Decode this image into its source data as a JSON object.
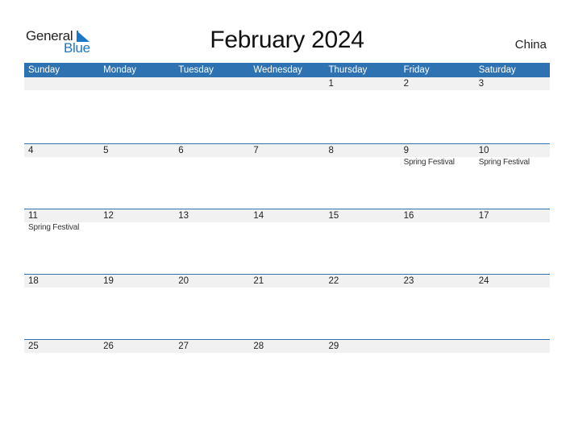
{
  "logo": {
    "line1": "General",
    "line2": "Blue"
  },
  "title": "February 2024",
  "country": "China",
  "colors": {
    "accent": "#2e72b2",
    "date_strip": "#f1f1f1",
    "logo_blue": "#1a78c8"
  },
  "weekdays": [
    "Sunday",
    "Monday",
    "Tuesday",
    "Wednesday",
    "Thursday",
    "Friday",
    "Saturday"
  ],
  "weeks": [
    [
      {
        "day": "",
        "event": ""
      },
      {
        "day": "",
        "event": ""
      },
      {
        "day": "",
        "event": ""
      },
      {
        "day": "",
        "event": ""
      },
      {
        "day": "1",
        "event": ""
      },
      {
        "day": "2",
        "event": ""
      },
      {
        "day": "3",
        "event": ""
      }
    ],
    [
      {
        "day": "4",
        "event": ""
      },
      {
        "day": "5",
        "event": ""
      },
      {
        "day": "6",
        "event": ""
      },
      {
        "day": "7",
        "event": ""
      },
      {
        "day": "8",
        "event": ""
      },
      {
        "day": "9",
        "event": "Spring Festival"
      },
      {
        "day": "10",
        "event": "Spring Festival"
      }
    ],
    [
      {
        "day": "11",
        "event": "Spring Festival"
      },
      {
        "day": "12",
        "event": ""
      },
      {
        "day": "13",
        "event": ""
      },
      {
        "day": "14",
        "event": ""
      },
      {
        "day": "15",
        "event": ""
      },
      {
        "day": "16",
        "event": ""
      },
      {
        "day": "17",
        "event": ""
      }
    ],
    [
      {
        "day": "18",
        "event": ""
      },
      {
        "day": "19",
        "event": ""
      },
      {
        "day": "20",
        "event": ""
      },
      {
        "day": "21",
        "event": ""
      },
      {
        "day": "22",
        "event": ""
      },
      {
        "day": "23",
        "event": ""
      },
      {
        "day": "24",
        "event": ""
      }
    ],
    [
      {
        "day": "25",
        "event": ""
      },
      {
        "day": "26",
        "event": ""
      },
      {
        "day": "27",
        "event": ""
      },
      {
        "day": "28",
        "event": ""
      },
      {
        "day": "29",
        "event": ""
      },
      {
        "day": "",
        "event": ""
      },
      {
        "day": "",
        "event": ""
      }
    ]
  ]
}
